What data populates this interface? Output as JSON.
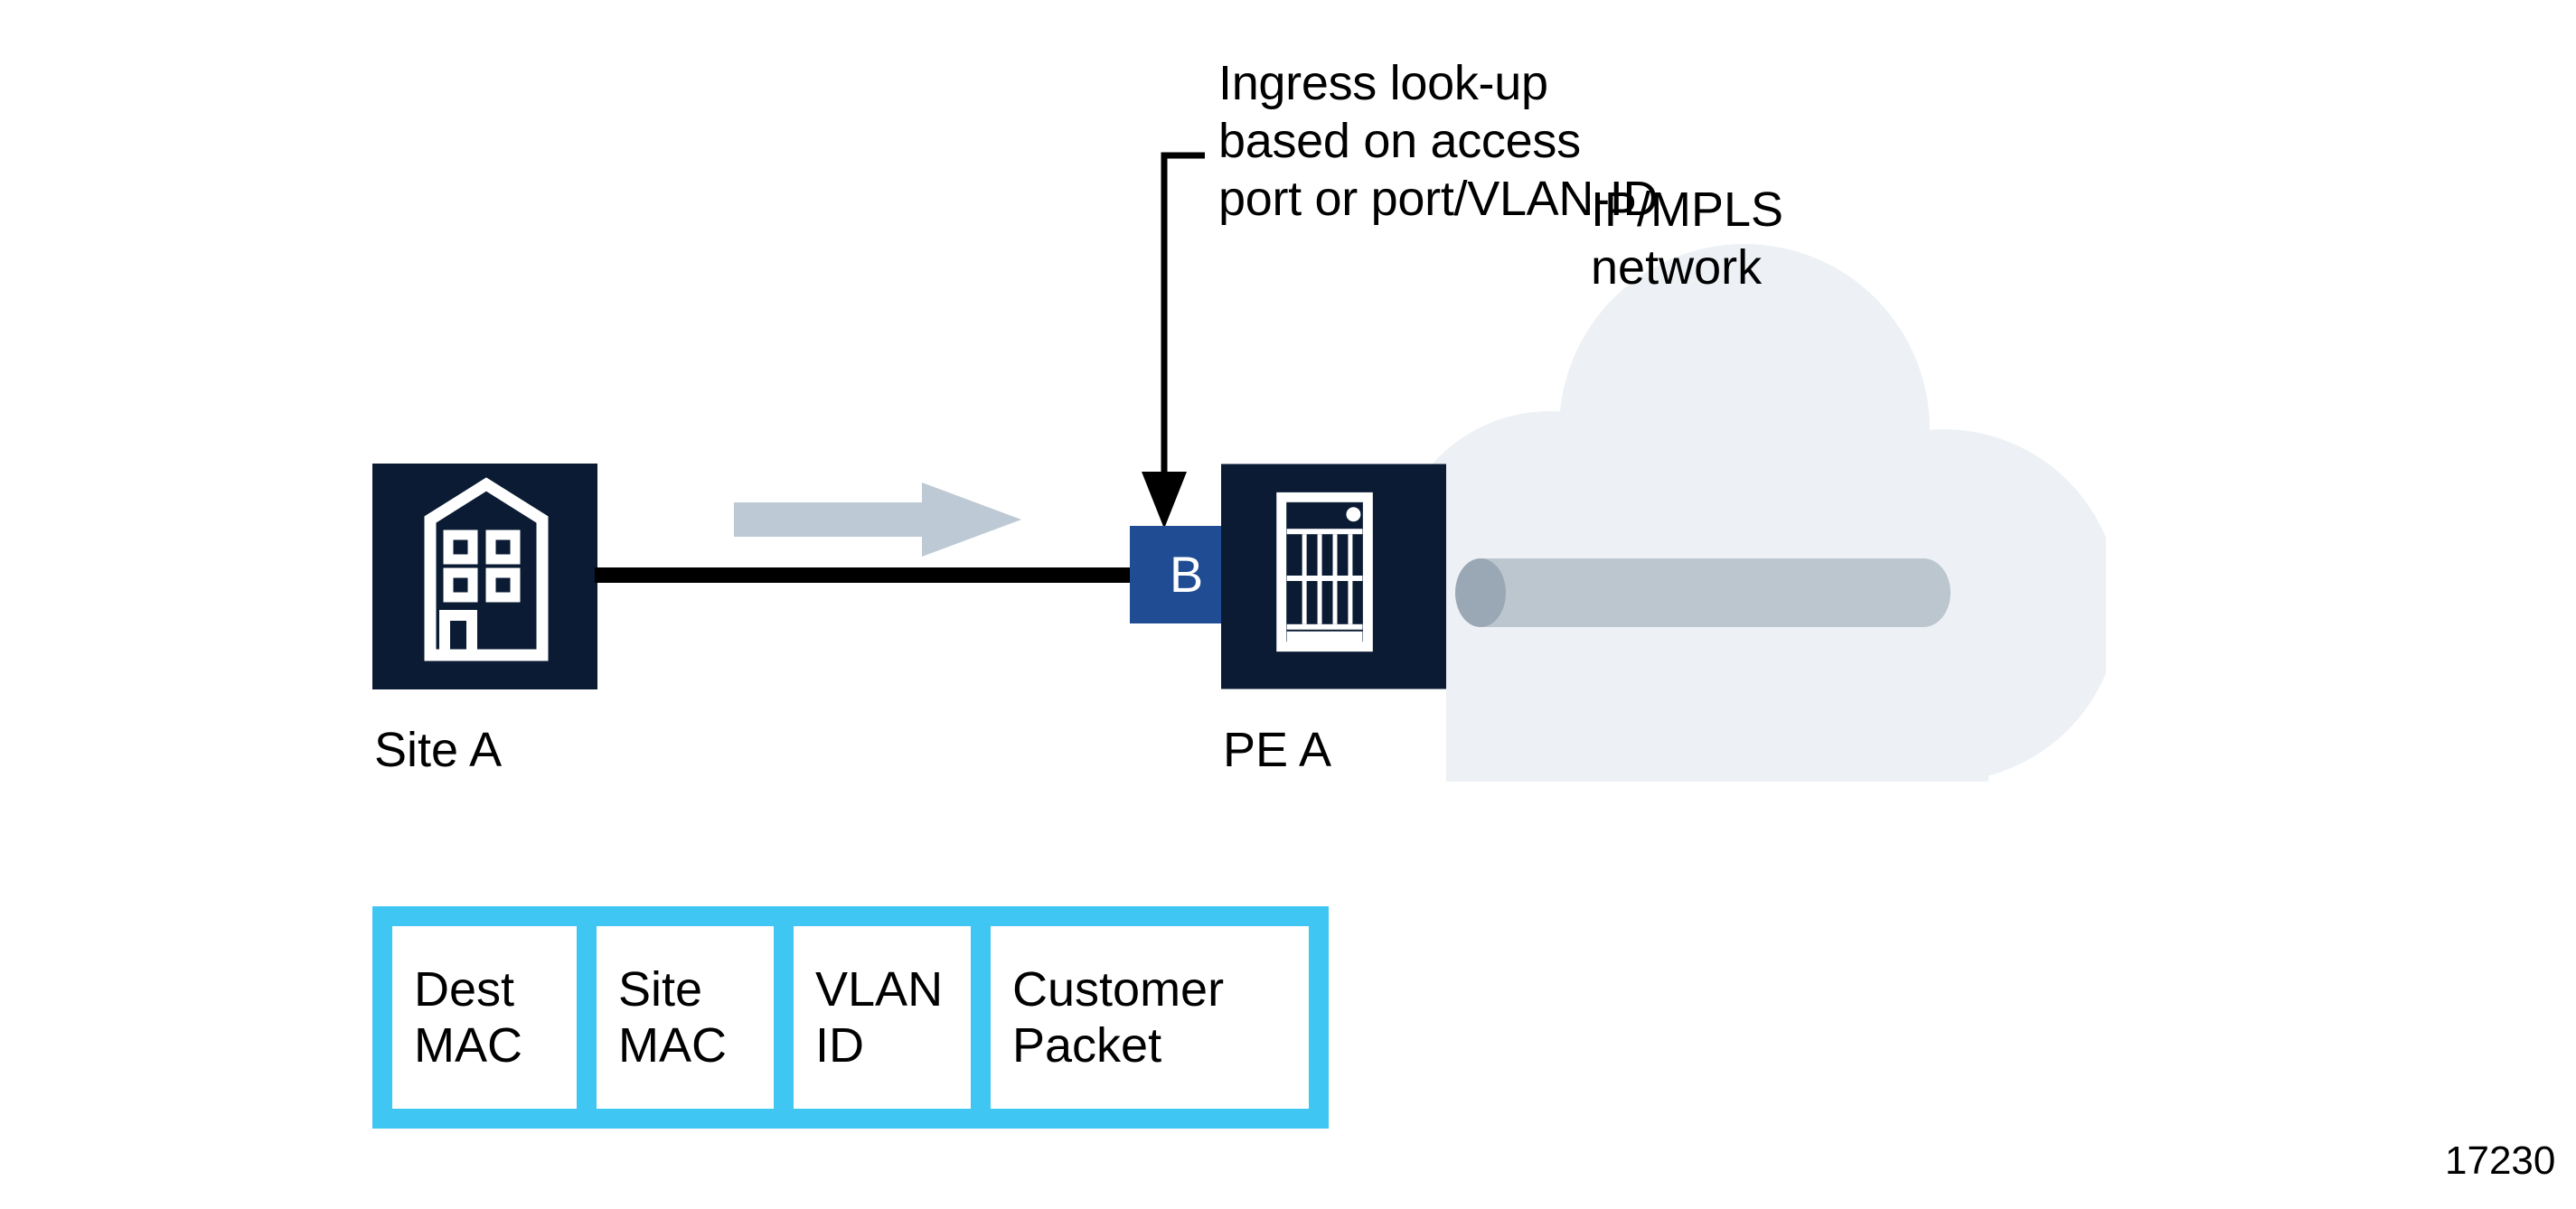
{
  "figure": {
    "number": "17230"
  },
  "annotation": {
    "text": "Ingress look-up\nbased on access\nport or port/VLAN-ID",
    "leader_icon": "elbow-arrow-down-icon"
  },
  "nodes": {
    "site_a": {
      "label": "Site A",
      "icon": "building-icon"
    },
    "pe_a": {
      "label": "PE A",
      "icon": "router-rack-icon"
    },
    "bridge_badge": {
      "label": "B"
    }
  },
  "cloud": {
    "label": "IP/MPLS\nnetwork",
    "icon": "cloud-icon",
    "tunnel_icon": "tunnel-pipe-icon"
  },
  "flow": {
    "direction_icon": "right-arrow-icon",
    "link_icon": "access-link-icon"
  },
  "packet": {
    "fields": [
      {
        "label": "Dest\nMAC"
      },
      {
        "label": "Site\nMAC"
      },
      {
        "label": "VLAN\nID"
      },
      {
        "label": "Customer\nPacket"
      }
    ]
  },
  "colors": {
    "node_navy": "#0a1b33",
    "badge_blue": "#1f4c93",
    "cloud_fill": "#edf1f5",
    "tunnel_gray": "#bcc6cf",
    "tunnel_cap_gray": "#9aa7b4",
    "arrow_gray": "#bdc9d4",
    "packet_cyan": "#3fc6f2",
    "line_black": "#000000"
  }
}
